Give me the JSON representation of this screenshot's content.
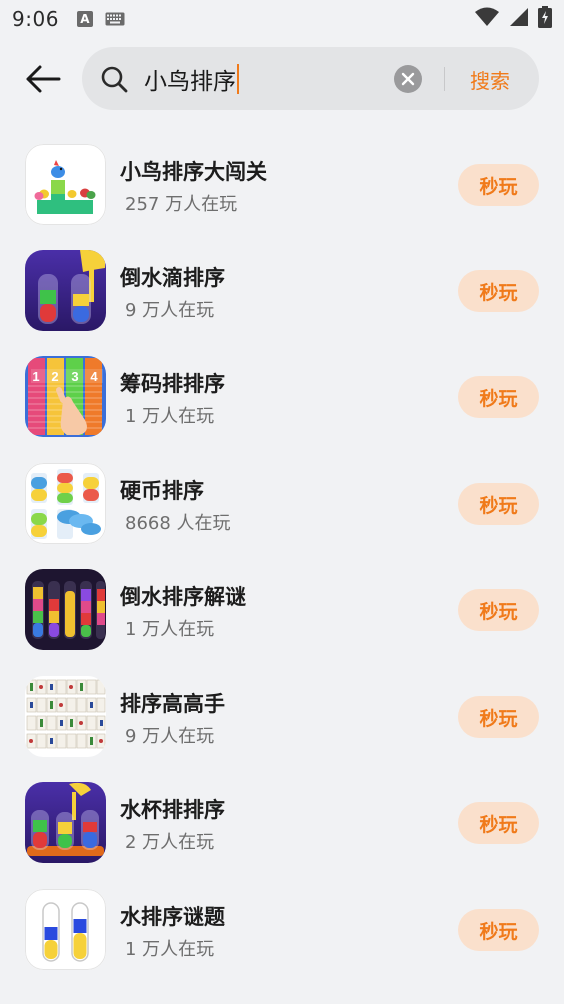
{
  "status_bar": {
    "time": "9:06",
    "a_badge": "A"
  },
  "search": {
    "query": "小鸟排序",
    "search_label": "搜索"
  },
  "results": [
    {
      "name": "小鸟排序大闯关",
      "players": "257 万人在玩",
      "play_label": "秒玩",
      "icon": "bird-sort-icon"
    },
    {
      "name": "倒水滴排序",
      "players": "9 万人在玩",
      "play_label": "秒玩",
      "icon": "water-drop-sort-icon"
    },
    {
      "name": "筹码排排序",
      "players": "1 万人在玩",
      "play_label": "秒玩",
      "icon": "chip-sort-icon"
    },
    {
      "name": "硬币排序",
      "players": "8668 人在玩",
      "play_label": "秒玩",
      "icon": "coin-sort-icon"
    },
    {
      "name": "倒水排序解谜",
      "players": "1 万人在玩",
      "play_label": "秒玩",
      "icon": "water-pour-sort-icon"
    },
    {
      "name": "排序高高手",
      "players": "9 万人在玩",
      "play_label": "秒玩",
      "icon": "mahjong-sort-icon"
    },
    {
      "name": "水杯排排序",
      "players": "2 万人在玩",
      "play_label": "秒玩",
      "icon": "cup-sort-icon"
    },
    {
      "name": "水排序谜题",
      "players": "1 万人在玩",
      "play_label": "秒玩",
      "icon": "water-tube-puzzle-icon"
    }
  ],
  "chip_icon_numbers": [
    "1",
    "2",
    "3",
    "4"
  ],
  "colors": {
    "accent": "#f07a1a",
    "play_button_bg": "#fae0cc",
    "background": "#f1f2f4"
  }
}
